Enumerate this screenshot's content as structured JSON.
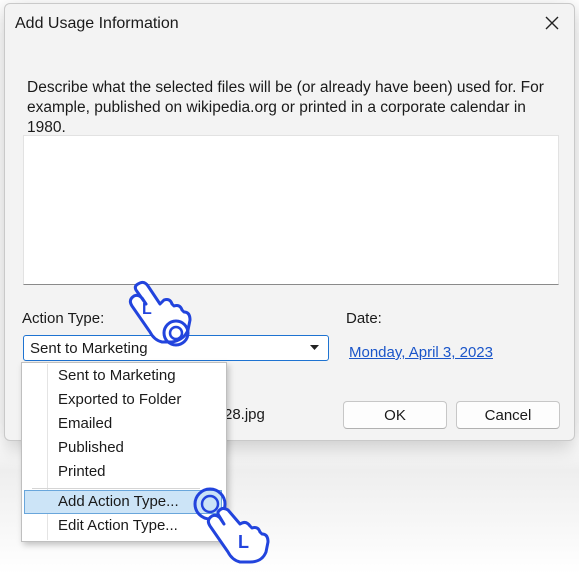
{
  "dialog": {
    "title": "Add Usage Information",
    "description": "Describe what the selected files will be (or already have been) used for. For example, published on wikipedia.org or printed in a corporate calendar in 1980.",
    "usage_text": ""
  },
  "action_type": {
    "label": "Action Type:",
    "selected": "Sent to Marketing",
    "options": [
      "Sent to Marketing",
      "Exported to Folder",
      "Emailed",
      "Published",
      "Printed"
    ],
    "extra_options": [
      "Add Action Type...",
      "Edit Action Type..."
    ],
    "highlighted": "Add Action Type..."
  },
  "date": {
    "label": "Date:",
    "value": "Monday, April 3, 2023"
  },
  "file_fragment": "28.jpg",
  "buttons": {
    "ok": "OK",
    "cancel": "Cancel"
  },
  "cursor_hints": {
    "letter_top": "L",
    "letter_bottom": "L"
  },
  "colors": {
    "accent": "#1e73d1",
    "link": "#1a55c9",
    "highlight_bg": "#cce4f7",
    "highlight_border": "#69a6db",
    "hand_outline": "#2244dd"
  },
  "icons": [
    "close-icon",
    "chevron-down-icon",
    "pointing-hand-icon"
  ]
}
